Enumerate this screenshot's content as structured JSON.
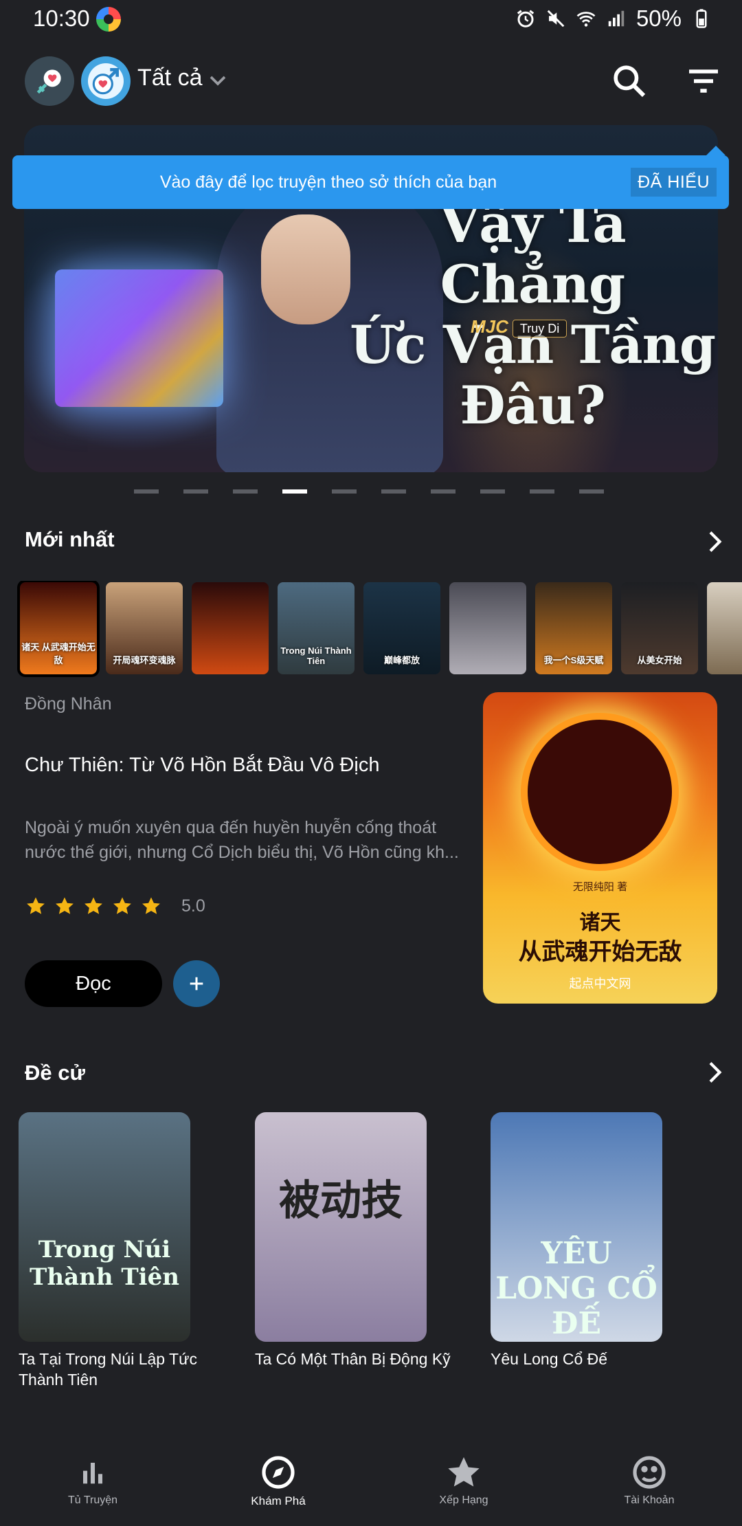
{
  "status_bar": {
    "time": "10:30",
    "battery": "50%"
  },
  "top_bar": {
    "filter_label": "Tất cả"
  },
  "banner": {
    "title_line1": "Vậy Ta Chẳng",
    "title_line2": "Ức Vạn Tầng Đâu?",
    "logo_text": "MJC",
    "logo_sub": "Truy Di",
    "page_count": 10,
    "active_page": 4
  },
  "tooltip": {
    "text": "Vào đây để lọc truyện theo sở thích của bạn",
    "button": "ĐÃ HIỂU"
  },
  "latest": {
    "title": "Mới nhất",
    "thumbnails": [
      {
        "label": "诸天 从武魂开始无敌",
        "selected": true,
        "color_top": "#3a0906",
        "color_bottom": "#f07a1d"
      },
      {
        "label": "开局魂环变魂脉",
        "selected": false,
        "color_top": "#c9a27a",
        "color_bottom": "#4a2a1a"
      },
      {
        "label": "",
        "selected": false,
        "color_top": "#2a0a0a",
        "color_bottom": "#d04a12"
      },
      {
        "label": "Trong Núi Thành Tiên",
        "selected": false,
        "color_top": "#4d6a80",
        "color_bottom": "#2f3b3f"
      },
      {
        "label": "巅峰都放",
        "selected": false,
        "color_top": "#1c3346",
        "color_bottom": "#0e1b25"
      },
      {
        "label": "",
        "selected": false,
        "color_top": "#4b4b55",
        "color_bottom": "#b0adb5"
      },
      {
        "label": "我一个S级天赋",
        "selected": false,
        "color_top": "#3a2a1a",
        "color_bottom": "#d07a20"
      },
      {
        "label": "从美女开始",
        "selected": false,
        "color_top": "#1d1f23",
        "color_bottom": "#4e3a2e"
      },
      {
        "label": "",
        "selected": false,
        "color_top": "#d8cfc0",
        "color_bottom": "#7d6b52"
      }
    ]
  },
  "featured": {
    "category": "Đồng Nhân",
    "title": "Chư Thiên: Từ Võ Hồn Bắt Đầu Vô Địch",
    "description": "Ngoài ý muốn xuyên qua đến huyền huyễn cống thoát nước thế giới, nhưng Cổ Dịch biểu thị, Võ Hồn cũng kh...",
    "rating": "5.0",
    "stars": 5,
    "read_button": "Đọc",
    "cover": {
      "author": "无限纯阳 著",
      "line1": "诸天",
      "line2": "从武魂开始无敌",
      "publisher": "起点中文网"
    }
  },
  "recommended": {
    "title": "Đề cử",
    "items": [
      {
        "title": "Ta Tại Trong Núi Lập Tức Thành Tiên",
        "cover_text": "Trong Núi Thành Tiên",
        "cover_top": "#5a7283",
        "cover_bottom": "#2b2f2c"
      },
      {
        "title": "Ta Có Một Thân Bị Động Kỹ",
        "cover_text": "被动技",
        "cover_top": "#c9c0cf",
        "cover_bottom": "#8b7ea0"
      },
      {
        "title": "Yêu Long Cổ Đế",
        "cover_text": "YÊU LONG CỔ ĐẾ",
        "cover_top": "#4d78b5",
        "cover_bottom": "#cfd8e6"
      }
    ]
  },
  "bottom_nav": {
    "items": [
      {
        "label": "Tủ Truyện",
        "icon": "bar-chart-icon",
        "active": false
      },
      {
        "label": "Khám Phá",
        "icon": "compass-icon",
        "active": true
      },
      {
        "label": "Xếp Hạng",
        "icon": "star-icon",
        "active": false
      },
      {
        "label": "Tài Khoản",
        "icon": "face-icon",
        "active": false
      }
    ]
  }
}
